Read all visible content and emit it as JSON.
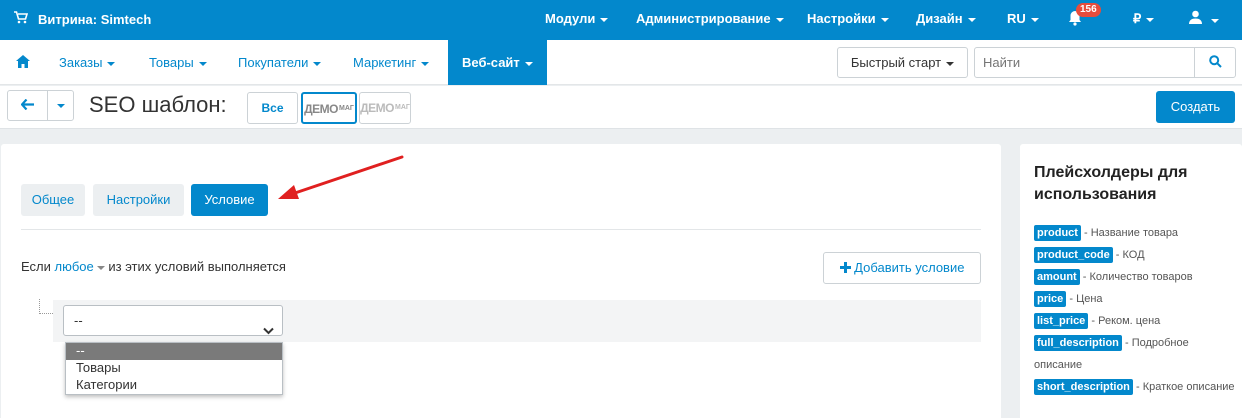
{
  "topbar": {
    "store_label": "Витрина: Simtech",
    "menus": [
      "Модули",
      "Администрирование",
      "Настройки",
      "Дизайн",
      "RU",
      "₽"
    ],
    "notification_count": "156",
    "colors": {
      "primary": "#0388cc",
      "badge": "#e74c3c"
    }
  },
  "nav": {
    "items": [
      "Заказы",
      "Товары",
      "Покупатели",
      "Маркетинг",
      "Веб-сайт"
    ],
    "active": "Веб-сайт",
    "quick_start": "Быстрый старт",
    "search_placeholder": "Найти"
  },
  "toolbar": {
    "title": "SEO шаблон:",
    "storefront_all": "Все",
    "demo_logo_1": "ДЕМО",
    "demo_logo_1_small": "МАГ",
    "demo_logo_2": "ДЕМО",
    "demo_logo_2_small": "МАГ",
    "create_label": "Создать"
  },
  "main": {
    "tabs": [
      "Общее",
      "Настройки",
      "Условие"
    ],
    "active_tab": "Условие",
    "condition": {
      "prefix": "Если",
      "mode": "любое",
      "suffix": "из этих условий выполняется"
    },
    "add_condition_label": "Добавить условие",
    "select": {
      "value": "--",
      "options": [
        "--",
        "Товары",
        "Категории"
      ]
    }
  },
  "sidebar": {
    "title": "Плейсхолдеры для использования",
    "placeholders": [
      {
        "tag": "product",
        "desc": "- Название товара"
      },
      {
        "tag": "product_code",
        "desc": "- КОД"
      },
      {
        "tag": "amount",
        "desc": "- Количество товаров"
      },
      {
        "tag": "price",
        "desc": "- Цена"
      },
      {
        "tag": "list_price",
        "desc": "- Реком. цена"
      },
      {
        "tag": "full_description",
        "desc": "- Подробное описание"
      },
      {
        "tag": "short_description",
        "desc": "- Краткое описание"
      }
    ]
  },
  "annotation": {
    "arrow_color": "#e02020"
  }
}
